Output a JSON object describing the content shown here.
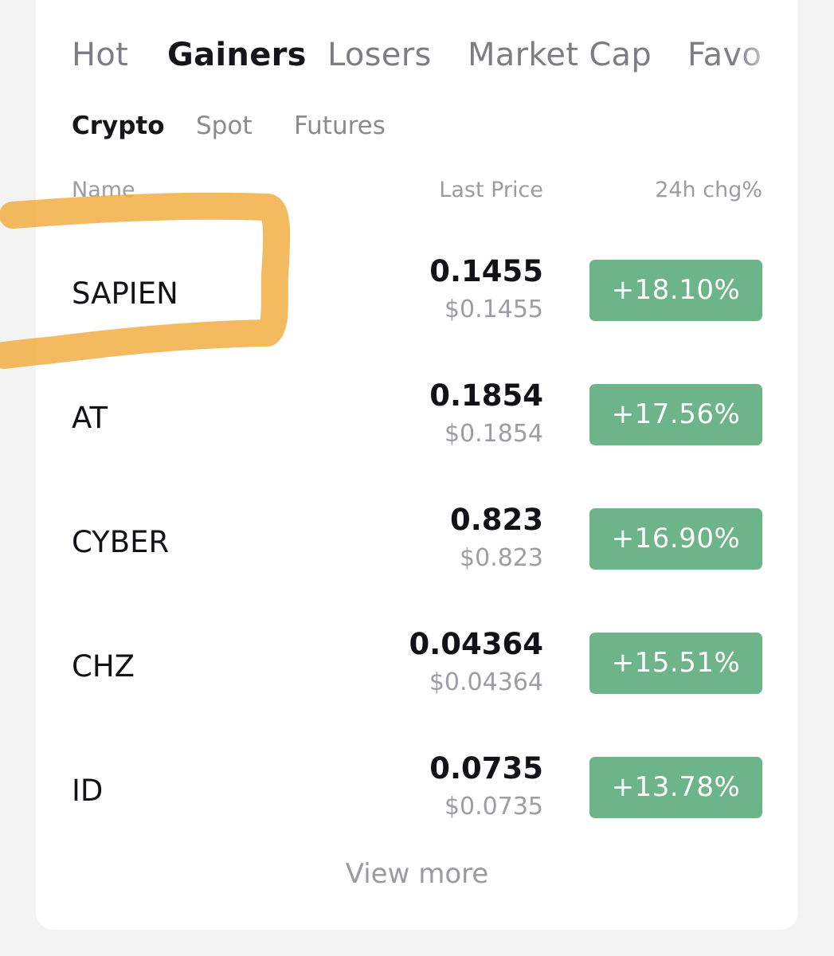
{
  "tabs": [
    {
      "label": "Hot",
      "active": false
    },
    {
      "label": "Gainers",
      "active": true
    },
    {
      "label": "Losers",
      "active": false
    },
    {
      "label": "Market Cap",
      "active": false
    },
    {
      "label": "Favo",
      "active": false
    }
  ],
  "subtabs": [
    {
      "label": "Crypto",
      "active": true
    },
    {
      "label": "Spot",
      "active": false
    },
    {
      "label": "Futures",
      "active": false
    }
  ],
  "columns": {
    "name": "Name",
    "last_price": "Last Price",
    "change": "24h chg%"
  },
  "rows": [
    {
      "symbol": "SAPIEN",
      "price": "0.1455",
      "usd": "$0.1455",
      "change": "+18.10%"
    },
    {
      "symbol": "AT",
      "price": "0.1854",
      "usd": "$0.1854",
      "change": "+17.56%"
    },
    {
      "symbol": "CYBER",
      "price": "0.823",
      "usd": "$0.823",
      "change": "+16.90%"
    },
    {
      "symbol": "CHZ",
      "price": "0.04364",
      "usd": "$0.04364",
      "change": "+15.51%"
    },
    {
      "symbol": "ID",
      "price": "0.0735",
      "usd": "$0.0735",
      "change": "+13.78%"
    }
  ],
  "view_more": "View more",
  "colors": {
    "gain": "#6db48a",
    "highlight": "#f2ab3c"
  },
  "annotation": {
    "type": "hand-drawn-highlight",
    "target": "SAPIEN"
  }
}
